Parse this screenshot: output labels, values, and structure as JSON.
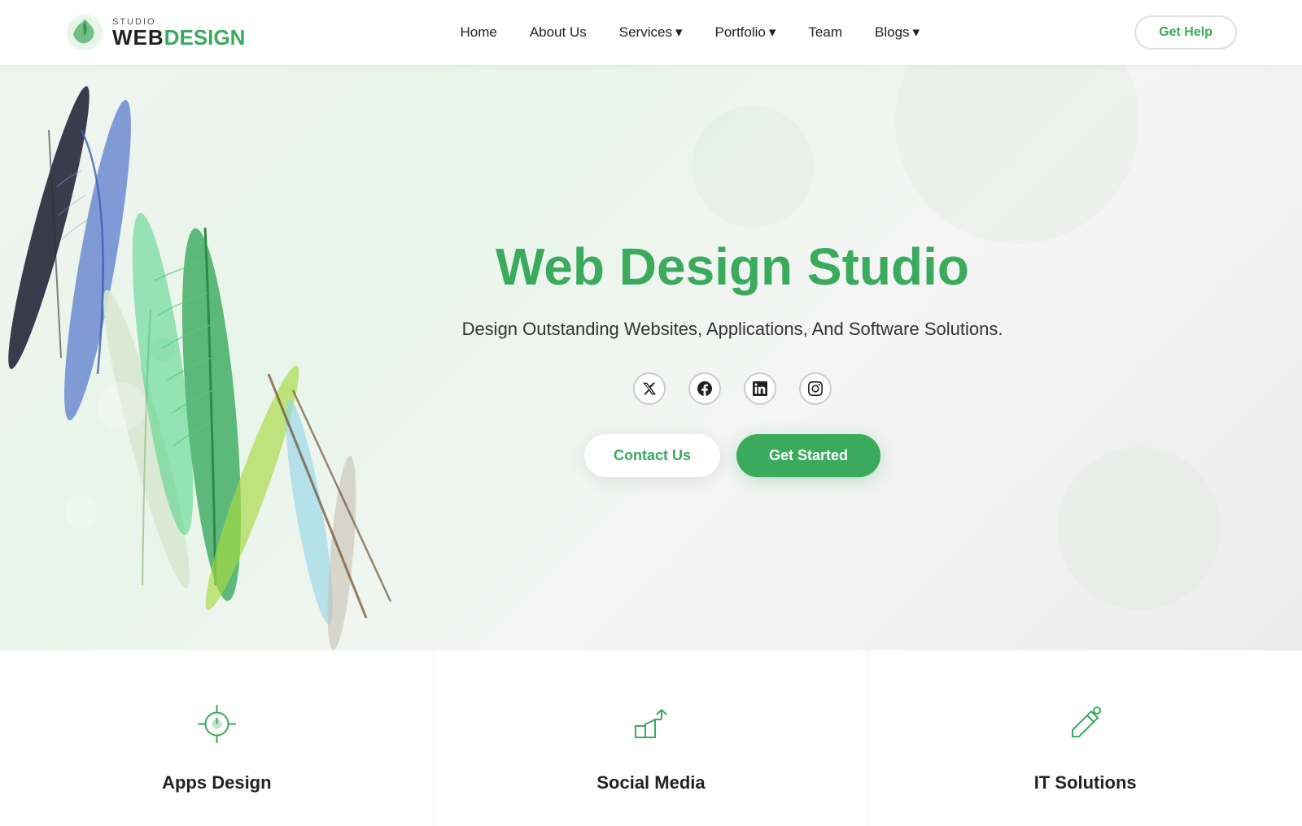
{
  "navbar": {
    "logo": {
      "studio_text": "STUDIO",
      "web_text": "WEB",
      "design_text": "DESIGN"
    },
    "nav_links": [
      {
        "label": "Home",
        "has_dropdown": false
      },
      {
        "label": "About Us",
        "has_dropdown": false
      },
      {
        "label": "Services",
        "has_dropdown": true
      },
      {
        "label": "Portfolio",
        "has_dropdown": true
      },
      {
        "label": "Team",
        "has_dropdown": false
      },
      {
        "label": "Blogs",
        "has_dropdown": true
      }
    ],
    "cta_button": "Get Help"
  },
  "hero": {
    "title": "Web Design Studio",
    "subtitle": "Design Outstanding Websites, Applications, And Software Solutions.",
    "contact_btn": "Contact Us",
    "started_btn": "Get Started",
    "social_icons": [
      {
        "name": "twitter",
        "symbol": "𝕏"
      },
      {
        "name": "facebook",
        "symbol": "f"
      },
      {
        "name": "linkedin",
        "symbol": "in"
      },
      {
        "name": "instagram",
        "symbol": "◎"
      }
    ]
  },
  "services": [
    {
      "title": "Apps Design",
      "icon": "bulb"
    },
    {
      "title": "Social Media",
      "icon": "megaphone"
    },
    {
      "title": "IT Solutions",
      "icon": "wrench"
    }
  ],
  "colors": {
    "green": "#3aaa5c",
    "dark": "#222222",
    "light_bg": "#f8f9fa"
  }
}
